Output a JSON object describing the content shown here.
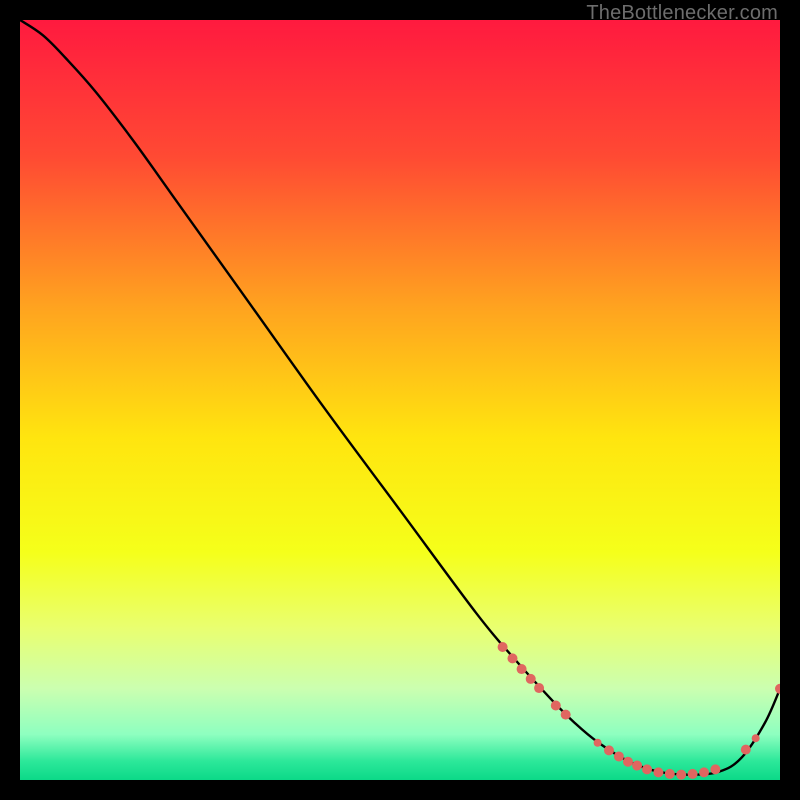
{
  "watermark": "TheBottlenecker.com",
  "chart_data": {
    "type": "line",
    "title": "",
    "xlabel": "",
    "ylabel": "",
    "xlim": [
      0,
      100
    ],
    "ylim": [
      0,
      100
    ],
    "background": {
      "type": "vertical-gradient",
      "stops": [
        {
          "pos": 0.0,
          "color": "#ff1a3f"
        },
        {
          "pos": 0.18,
          "color": "#ff4a33"
        },
        {
          "pos": 0.38,
          "color": "#ffa41f"
        },
        {
          "pos": 0.55,
          "color": "#ffe50f"
        },
        {
          "pos": 0.7,
          "color": "#f5ff1a"
        },
        {
          "pos": 0.8,
          "color": "#e9ff70"
        },
        {
          "pos": 0.88,
          "color": "#cbffb0"
        },
        {
          "pos": 0.94,
          "color": "#8effc0"
        },
        {
          "pos": 0.975,
          "color": "#2de89a"
        },
        {
          "pos": 1.0,
          "color": "#0bd988"
        }
      ]
    },
    "series": [
      {
        "name": "bottleneck-curve",
        "color": "#000000",
        "x": [
          0,
          3,
          6,
          10,
          15,
          20,
          30,
          40,
          50,
          60,
          65,
          70,
          73,
          76,
          80,
          84,
          88,
          92,
          95,
          98,
          100
        ],
        "y": [
          100,
          98,
          95,
          90.5,
          84,
          77,
          63,
          49,
          35.5,
          22,
          16,
          10.5,
          7.5,
          5,
          2.5,
          1.1,
          0.7,
          1.1,
          3.0,
          7.5,
          12
        ]
      }
    ],
    "markers": {
      "name": "highlighted-points",
      "color": "#e06660",
      "points": [
        {
          "x": 63.5,
          "y": 17.5,
          "r": 5
        },
        {
          "x": 64.8,
          "y": 16.0,
          "r": 5
        },
        {
          "x": 66.0,
          "y": 14.6,
          "r": 5
        },
        {
          "x": 67.2,
          "y": 13.3,
          "r": 5
        },
        {
          "x": 68.3,
          "y": 12.1,
          "r": 5
        },
        {
          "x": 70.5,
          "y": 9.8,
          "r": 5
        },
        {
          "x": 71.8,
          "y": 8.6,
          "r": 5
        },
        {
          "x": 76.0,
          "y": 4.9,
          "r": 4
        },
        {
          "x": 77.5,
          "y": 3.9,
          "r": 5
        },
        {
          "x": 78.8,
          "y": 3.1,
          "r": 5
        },
        {
          "x": 80.0,
          "y": 2.4,
          "r": 5
        },
        {
          "x": 81.2,
          "y": 1.9,
          "r": 5
        },
        {
          "x": 82.5,
          "y": 1.4,
          "r": 5
        },
        {
          "x": 84.0,
          "y": 1.0,
          "r": 5
        },
        {
          "x": 85.5,
          "y": 0.8,
          "r": 5
        },
        {
          "x": 87.0,
          "y": 0.7,
          "r": 5
        },
        {
          "x": 88.5,
          "y": 0.8,
          "r": 5
        },
        {
          "x": 90.0,
          "y": 1.0,
          "r": 5
        },
        {
          "x": 91.5,
          "y": 1.4,
          "r": 5
        },
        {
          "x": 95.5,
          "y": 4.0,
          "r": 5
        },
        {
          "x": 96.8,
          "y": 5.5,
          "r": 4
        },
        {
          "x": 100,
          "y": 12.0,
          "r": 5
        }
      ]
    }
  }
}
